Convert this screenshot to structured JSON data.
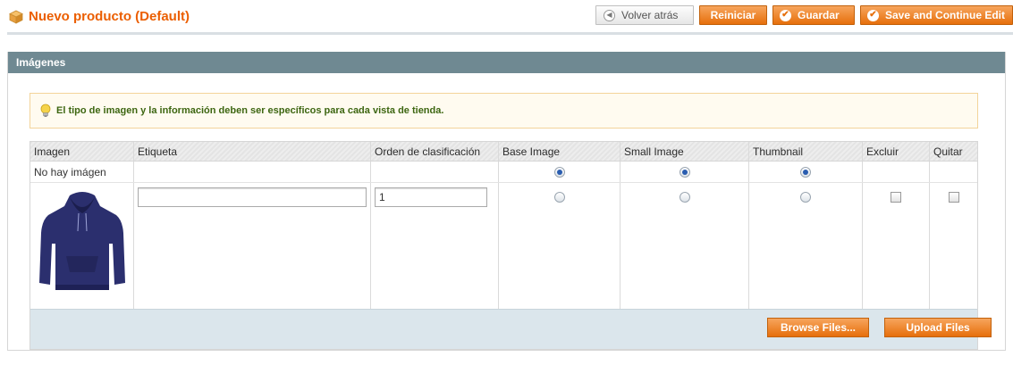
{
  "header": {
    "title": "Nuevo producto (Default)",
    "icon": "box-icon",
    "buttons": {
      "back": "Volver atrás",
      "reset": "Reiniciar",
      "save": "Guardar",
      "save_continue": "Save and Continue Edit"
    }
  },
  "section": {
    "title": "Imágenes",
    "notice": "El tipo de imagen y la información deben ser específicos para cada vista de tienda."
  },
  "gallery": {
    "columns": [
      "Imagen",
      "Etiqueta",
      "Orden de clasificación",
      "Base Image",
      "Small Image",
      "Thumbnail",
      "Excluir",
      "Quitar"
    ],
    "no_image_row": {
      "label": "No hay imágen",
      "base_image_selected": true,
      "small_image_selected": true,
      "thumbnail_selected": true
    },
    "items": [
      {
        "image": "navy hoodie",
        "label_value": "",
        "sort_order": "1",
        "base_image_selected": false,
        "small_image_selected": false,
        "thumbnail_selected": false,
        "exclude_checked": false,
        "remove_checked": false
      }
    ],
    "footer": {
      "browse_label": "Browse Files...",
      "upload_label": "Upload Files"
    }
  },
  "colors": {
    "accent_orange": "#eb5e00",
    "section_header": "#6f8992",
    "notice_text": "#3d6611",
    "hoodie": "#2b2f6e"
  }
}
